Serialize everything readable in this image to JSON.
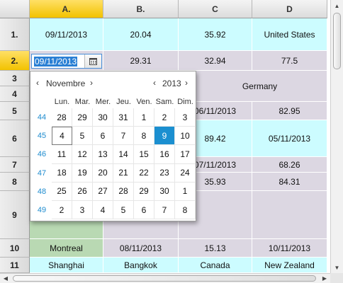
{
  "columns": [
    "A.",
    "B.",
    "C",
    "D"
  ],
  "rows": [
    "1.",
    "2.",
    "3",
    "4",
    "5",
    "6",
    "7",
    "8",
    "9",
    "10",
    "11"
  ],
  "cells": {
    "r1": [
      "09/11/2013",
      "20.04",
      "35.92",
      "United States"
    ],
    "r2": [
      "09/11/2013",
      "29.31",
      "32.94",
      "77.5"
    ],
    "r3_4_merged": "Germany",
    "r5": [
      "06/11/2013",
      "82.95"
    ],
    "r6": [
      "89.42",
      "05/11/2013"
    ],
    "r7": [
      "07/11/2013",
      "68.26"
    ],
    "r8": [
      "35.93",
      "84.31"
    ],
    "r10": [
      "Montreal",
      "08/11/2013",
      "15.13",
      "10/11/2013"
    ],
    "r11": [
      "Shanghai",
      "Bangkok",
      "Canada",
      "New Zealand"
    ]
  },
  "date_field": {
    "value": "09/11/2013",
    "icon": "calendar-icon"
  },
  "calendar": {
    "month": "Novembre",
    "year": "2013",
    "prev_symbol": "‹",
    "next_symbol": "›",
    "weekdays": [
      "Lun.",
      "Mar.",
      "Mer.",
      "Jeu.",
      "Ven.",
      "Sam.",
      "Dim."
    ],
    "weeks": [
      {
        "num": "44",
        "days": [
          "28",
          "29",
          "30",
          "31",
          "1",
          "2",
          "3"
        ]
      },
      {
        "num": "45",
        "days": [
          "4",
          "5",
          "6",
          "7",
          "8",
          "9",
          "10"
        ]
      },
      {
        "num": "46",
        "days": [
          "11",
          "12",
          "13",
          "14",
          "15",
          "16",
          "17"
        ]
      },
      {
        "num": "47",
        "days": [
          "18",
          "19",
          "20",
          "21",
          "22",
          "23",
          "24"
        ]
      },
      {
        "num": "48",
        "days": [
          "25",
          "26",
          "27",
          "28",
          "29",
          "30",
          "1"
        ]
      },
      {
        "num": "49",
        "days": [
          "2",
          "3",
          "4",
          "5",
          "6",
          "7",
          "8"
        ]
      }
    ],
    "today": "4",
    "selected": "9"
  }
}
